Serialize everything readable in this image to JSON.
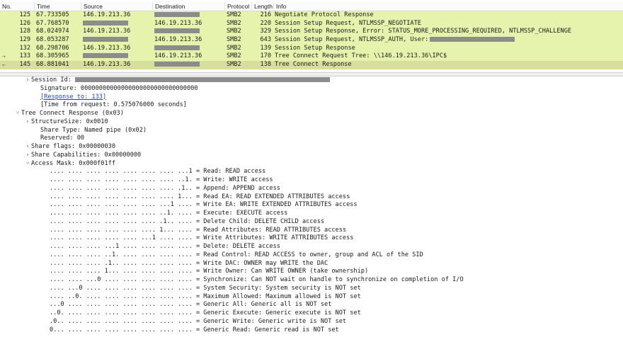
{
  "columns": [
    "No.",
    "Time",
    "Source",
    "Destination",
    "Protocol",
    "Length",
    "Info"
  ],
  "packets": [
    {
      "no": "125",
      "time": "67.733505",
      "src": "146.19.213.36",
      "dst": "",
      "proto": "SMB2",
      "len": "216",
      "info": "Negotiate Protocol Response",
      "src_redacted": false,
      "dst_redacted": true,
      "mark": ""
    },
    {
      "no": "126",
      "time": "67.768570",
      "src": "",
      "dst": "146.19.213.36",
      "proto": "SMB2",
      "len": "220",
      "info": "Session Setup Request, NTLMSSP_NEGOTIATE",
      "src_redacted": true,
      "dst_redacted": false,
      "mark": ""
    },
    {
      "no": "128",
      "time": "68.024974",
      "src": "146.19.213.36",
      "dst": "",
      "proto": "SMB2",
      "len": "329",
      "info": "Session Setup Response, Error: STATUS_MORE_PROCESSING_REQUIRED, NTLMSSP_CHALLENGE",
      "src_redacted": false,
      "dst_redacted": true,
      "mark": ""
    },
    {
      "no": "129",
      "time": "68.053287",
      "src": "",
      "dst": "146.19.213.36",
      "proto": "SMB2",
      "len": "643",
      "info": "Session Setup Request, NTLMSSP_AUTH, User:",
      "src_redacted": true,
      "dst_redacted": false,
      "mark": ""
    },
    {
      "no": "132",
      "time": "68.298706",
      "src": "146.19.213.36",
      "dst": "",
      "proto": "SMB2",
      "len": "139",
      "info": "Session Setup Response",
      "src_redacted": false,
      "dst_redacted": true,
      "mark": ""
    },
    {
      "no": "133",
      "time": "68.305965",
      "src": "",
      "dst": "146.19.213.36",
      "proto": "SMB2",
      "len": "170",
      "info": "Tree Connect Request Tree: \\\\146.19.213.36\\IPC$",
      "src_redacted": true,
      "dst_redacted": false,
      "mark": "→"
    },
    {
      "no": "145",
      "time": "68.881041",
      "src": "146.19.213.36",
      "dst": "",
      "proto": "SMB2",
      "len": "138",
      "info": "Tree Connect Response",
      "src_redacted": false,
      "dst_redacted": true,
      "mark": "←"
    }
  ],
  "details": [
    {
      "indent": 1,
      "toggle": "›",
      "text": "Session Id: ",
      "redact": true
    },
    {
      "indent": 2,
      "toggle": "",
      "text": "Signature: 00000000000000000000000000000000"
    },
    {
      "indent": 2,
      "toggle": "",
      "text": "[Response to: 133]",
      "link": true
    },
    {
      "indent": 2,
      "toggle": "",
      "text": "[Time from request: 0.575076000 seconds]"
    },
    {
      "indent": 0,
      "toggle": "˅",
      "text": "Tree Connect Response (0x03)"
    },
    {
      "indent": 1,
      "toggle": "›",
      "text": "StructureSize: 0x0010"
    },
    {
      "indent": 2,
      "toggle": "",
      "text": "Share Type: Named pipe (0x02)"
    },
    {
      "indent": 2,
      "toggle": "",
      "text": "Reserved: 00"
    },
    {
      "indent": 1,
      "toggle": "›",
      "text": "Share flags: 0x00000030"
    },
    {
      "indent": 1,
      "toggle": "›",
      "text": "Share Capabilities: 0x00000000"
    },
    {
      "indent": 1,
      "toggle": "˅",
      "text": "Access Mask: 0x000f01ff"
    },
    {
      "indent": 3,
      "toggle": "",
      "text": ".... .... .... .... .... .... .... ...1 = Read: READ access"
    },
    {
      "indent": 3,
      "toggle": "",
      "text": ".... .... .... .... .... .... .... ..1. = Write: WRITE access"
    },
    {
      "indent": 3,
      "toggle": "",
      "text": ".... .... .... .... .... .... .... .1.. = Append: APPEND access"
    },
    {
      "indent": 3,
      "toggle": "",
      "text": ".... .... .... .... .... .... .... 1... = Read EA: READ EXTENDED ATTRIBUTES access"
    },
    {
      "indent": 3,
      "toggle": "",
      "text": ".... .... .... .... .... .... ...1 .... = Write EA: WRITE EXTENDED ATTRIBUTES access"
    },
    {
      "indent": 3,
      "toggle": "",
      "text": ".... .... .... .... .... .... ..1. .... = Execute: EXECUTE access"
    },
    {
      "indent": 3,
      "toggle": "",
      "text": ".... .... .... .... .... .... .1.. .... = Delete Child: DELETE CHILD access"
    },
    {
      "indent": 3,
      "toggle": "",
      "text": ".... .... .... .... .... .... 1... .... = Read Attributes: READ ATTRIBUTES access"
    },
    {
      "indent": 3,
      "toggle": "",
      "text": ".... .... .... .... .... ...1 .... .... = Write Attributes: WRITE ATTRIBUTES access"
    },
    {
      "indent": 3,
      "toggle": "",
      "text": ".... .... .... ...1 .... .... .... .... = Delete: DELETE access"
    },
    {
      "indent": 3,
      "toggle": "",
      "text": ".... .... .... ..1. .... .... .... .... = Read Control: READ ACCESS to owner, group and ACL of the SID"
    },
    {
      "indent": 3,
      "toggle": "",
      "text": ".... .... .... .1.. .... .... .... .... = Write DAC: OWNER may WRITE the DAC"
    },
    {
      "indent": 3,
      "toggle": "",
      "text": ".... .... .... 1... .... .... .... .... = Write Owner: Can WRITE OWNER (take ownership)"
    },
    {
      "indent": 3,
      "toggle": "",
      "text": ".... .... ...0 .... .... .... .... .... = Synchronize: Can NOT wait on handle to synchronize on completion of I/O"
    },
    {
      "indent": 3,
      "toggle": "",
      "text": ".... ...0 .... .... .... .... .... .... = System Security: System security is NOT set"
    },
    {
      "indent": 3,
      "toggle": "",
      "text": ".... ..0. .... .... .... .... .... .... = Maximum Allowed: Maximum allowed is NOT set"
    },
    {
      "indent": 3,
      "toggle": "",
      "text": "...0 .... .... .... .... .... .... .... = Generic All: Generic all is NOT set"
    },
    {
      "indent": 3,
      "toggle": "",
      "text": "..0. .... .... .... .... .... .... .... = Generic Execute: Generic execute is NOT set"
    },
    {
      "indent": 3,
      "toggle": "",
      "text": ".0.. .... .... .... .... .... .... .... = Generic Write: Generic write is NOT set"
    },
    {
      "indent": 3,
      "toggle": "",
      "text": "0... .... .... .... .... .... .... .... = Generic Read: Generic read is NOT set"
    }
  ],
  "colors": {
    "row": "#e6f3ad",
    "selected": "#d8de9c",
    "link": "#1a3fd6",
    "redaction": "#8c8c8c"
  }
}
